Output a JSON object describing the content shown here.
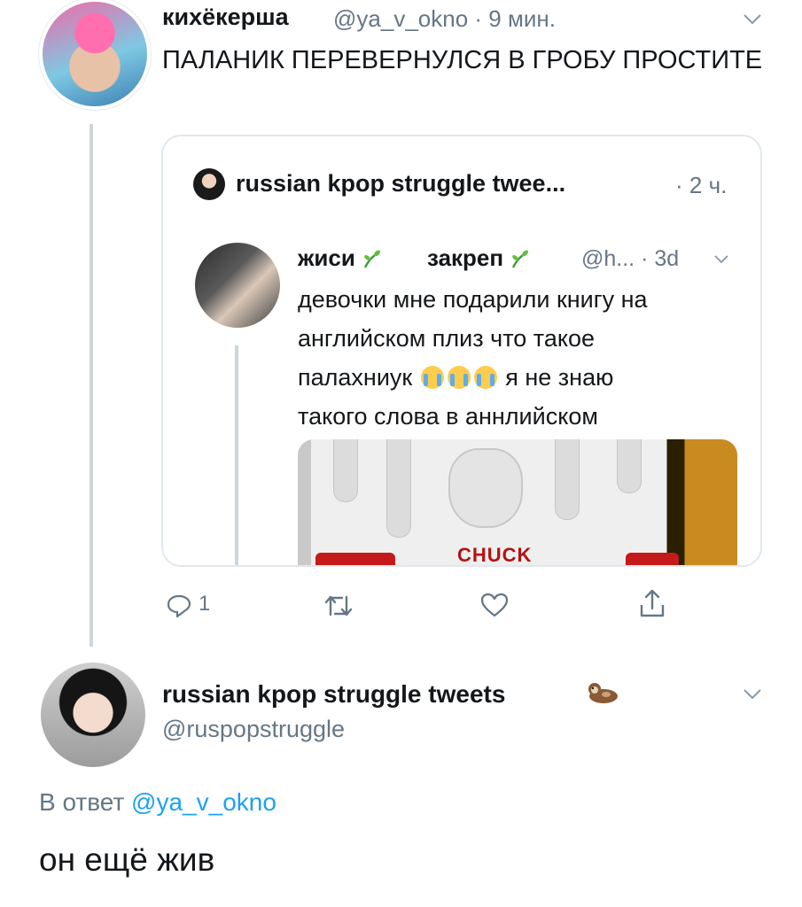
{
  "tweet1": {
    "display_name": "кихёкерша",
    "handle": "@ya_v_okno",
    "time": "· 9 мин.",
    "text": "ПАЛАНИК ПЕРЕВЕРНУЛСЯ В ГРОБУ ПРОСТИТЕ",
    "quote": {
      "name": "russian kpop struggle twee...",
      "time": "· 2 ч.",
      "embedded": {
        "name_part1": "жиси",
        "name_part2": "закреп",
        "handle_time": "@h... · 3d",
        "text_line1": "девочки мне подарили книгу на английском плиз что такое",
        "text_line2_a": "палахниук",
        "text_line2_b": "я не знаю",
        "text_line3": "такого слова в аннлийском",
        "image_text": "CHUCK"
      }
    },
    "actions": {
      "reply_count": "1"
    }
  },
  "tweet2": {
    "display_name": "russian kpop struggle tweets",
    "handle": "@ruspopstruggle",
    "reply_prefix": "В ответ",
    "reply_to": "@ya_v_okno",
    "text": "он ещё жив"
  },
  "colors": {
    "accent": "#1da1f2",
    "muted": "#657786",
    "border": "#e1e8ed",
    "text": "#14171a"
  },
  "icons": [
    "chevron-down-icon",
    "reply-icon",
    "retweet-icon",
    "like-icon",
    "share-icon",
    "sprout-emoji-icon",
    "crying-face-emoji-icon",
    "otter-emoji-icon"
  ]
}
